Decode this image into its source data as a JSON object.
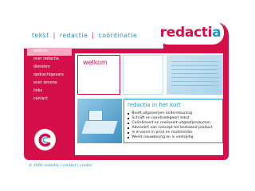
{
  "header": {
    "nav": [
      "tekst",
      "redactie",
      "coördinatie"
    ]
  },
  "logo": {
    "text_a": "redacti",
    "text_b": "a"
  },
  "sidebar": {
    "items": [
      {
        "label": "welkom"
      },
      {
        "label": "over redactia"
      },
      {
        "label": "diensten"
      },
      {
        "label": "opdrachtgevers"
      },
      {
        "label": "over simone"
      },
      {
        "label": "links"
      },
      {
        "label": "contact"
      }
    ],
    "active_index": 0
  },
  "main": {
    "welcome_title": "welkom",
    "summary": {
      "title": "redactia in het kort",
      "points": [
        "Biedt uitgeverijen ondersteuning",
        "Schrijft en (eind)redigeert tekst",
        "Coördineert en realiseert uitgeefproducten",
        "Adviseert van concept tot bestaand product",
        "Is ervaren in print en multimedia",
        "Werkt nauwkeurig en is veelzijdig"
      ]
    }
  },
  "footer": {
    "text": "© 2006 redactia | contact | credits"
  },
  "colors": {
    "brand_red": "#d50f49",
    "brand_blue": "#1b9ad1",
    "active_menu": "#f6a9bf"
  },
  "icons": {
    "logo_badge": "c-logo-icon"
  }
}
